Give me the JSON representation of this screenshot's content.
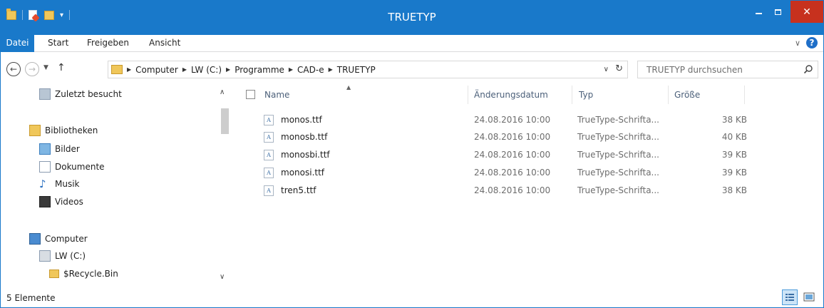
{
  "window": {
    "title": "TRUETYP",
    "accent": "#1979ca",
    "close_color": "#c7311e",
    "min_label": "",
    "max_label": "",
    "close_label": "✕"
  },
  "ribbon": {
    "tabs": [
      "Datei",
      "Start",
      "Freigeben",
      "Ansicht"
    ]
  },
  "address": {
    "segments": [
      "Computer",
      "LW (C:)",
      "Programme",
      "CAD-e",
      "TRUETYP"
    ]
  },
  "search": {
    "placeholder": "TRUETYP durchsuchen"
  },
  "nav": {
    "items": [
      {
        "label": "Zuletzt besucht",
        "icon": "recent-places-icon"
      },
      {
        "label": "Bibliotheken",
        "icon": "libraries-icon"
      },
      {
        "label": "Bilder",
        "icon": "pictures-icon"
      },
      {
        "label": "Dokumente",
        "icon": "documents-icon"
      },
      {
        "label": "Musik",
        "icon": "music-icon"
      },
      {
        "label": "Videos",
        "icon": "videos-icon"
      },
      {
        "label": "Computer",
        "icon": "computer-icon"
      },
      {
        "label": "LW (C:)",
        "icon": "drive-icon"
      },
      {
        "label": "$Recycle.Bin",
        "icon": "folder-icon"
      }
    ]
  },
  "columns": {
    "name": "Name",
    "date": "Änderungsdatum",
    "type": "Typ",
    "size": "Größe"
  },
  "files": [
    {
      "name": "monos.ttf",
      "date": "24.08.2016 10:00",
      "type": "TrueType-Schrifta...",
      "size": "38 KB"
    },
    {
      "name": "monosb.ttf",
      "date": "24.08.2016 10:00",
      "type": "TrueType-Schrifta...",
      "size": "40 KB"
    },
    {
      "name": "monosbi.ttf",
      "date": "24.08.2016 10:00",
      "type": "TrueType-Schrifta...",
      "size": "39 KB"
    },
    {
      "name": "monosi.ttf",
      "date": "24.08.2016 10:00",
      "type": "TrueType-Schrifta...",
      "size": "39 KB"
    },
    {
      "name": "tren5.ttf",
      "date": "24.08.2016 10:00",
      "type": "TrueType-Schrifta...",
      "size": "38 KB"
    }
  ],
  "status": {
    "count": "5 Elemente"
  }
}
